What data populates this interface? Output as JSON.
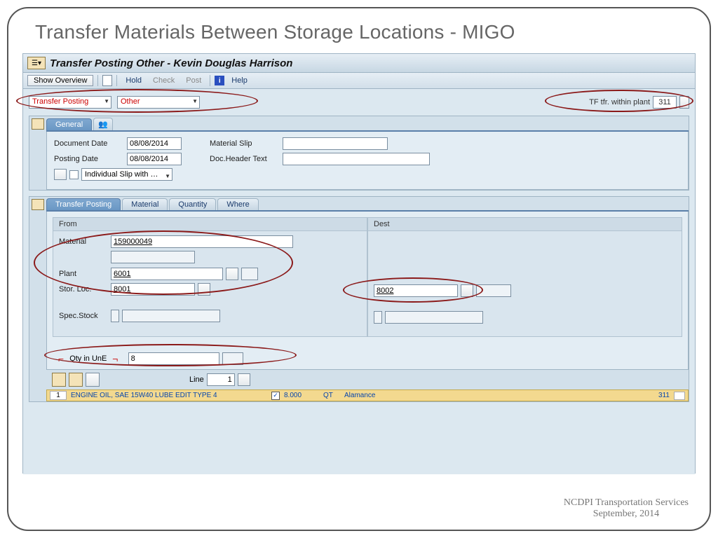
{
  "slide": {
    "title": "Transfer Materials Between Storage Locations - MIGO"
  },
  "window": {
    "title": "Transfer Posting Other - Kevin Douglas Harrison"
  },
  "toolbar": {
    "show_overview": "Show Overview",
    "hold": "Hold",
    "check": "Check",
    "post": "Post",
    "help": "Help"
  },
  "header": {
    "action": "Transfer Posting",
    "ref": "Other",
    "mvt_label": "TF tfr. within plant",
    "mvt_code": "311"
  },
  "general": {
    "tab_general": "General",
    "doc_date_label": "Document Date",
    "doc_date": "08/08/2014",
    "post_date_label": "Posting Date",
    "post_date": "08/08/2014",
    "mat_slip_label": "Material Slip",
    "mat_slip": "",
    "doc_hdr_label": "Doc.Header Text",
    "doc_hdr": "",
    "slip_dd": "Individual Slip with …"
  },
  "detail": {
    "tab_transfer": "Transfer Posting",
    "tab_material": "Material",
    "tab_quantity": "Quantity",
    "tab_where": "Where",
    "from_h": "From",
    "dest_h": "Dest",
    "material_label": "Material",
    "material": "159000049",
    "plant_label": "Plant",
    "plant": "6001",
    "sloc_label": "Stor. Loc.",
    "sloc_from": "8001",
    "sloc_dest": "8002",
    "spec_label": "Spec.Stock",
    "qty_label": "Qty in UnE",
    "qty": "8"
  },
  "footer": {
    "line_label": "Line",
    "line_no": "1"
  },
  "item": {
    "num": "1",
    "desc": "ENGINE OIL, SAE 15W40 LUBE EDIT TYPE 4",
    "qty": "8.000",
    "unit": "QT",
    "loc": "Alamance",
    "code": "311"
  },
  "watermark": {
    "l1": "NCDPI Transportation Services",
    "l2": "September, 2014"
  }
}
